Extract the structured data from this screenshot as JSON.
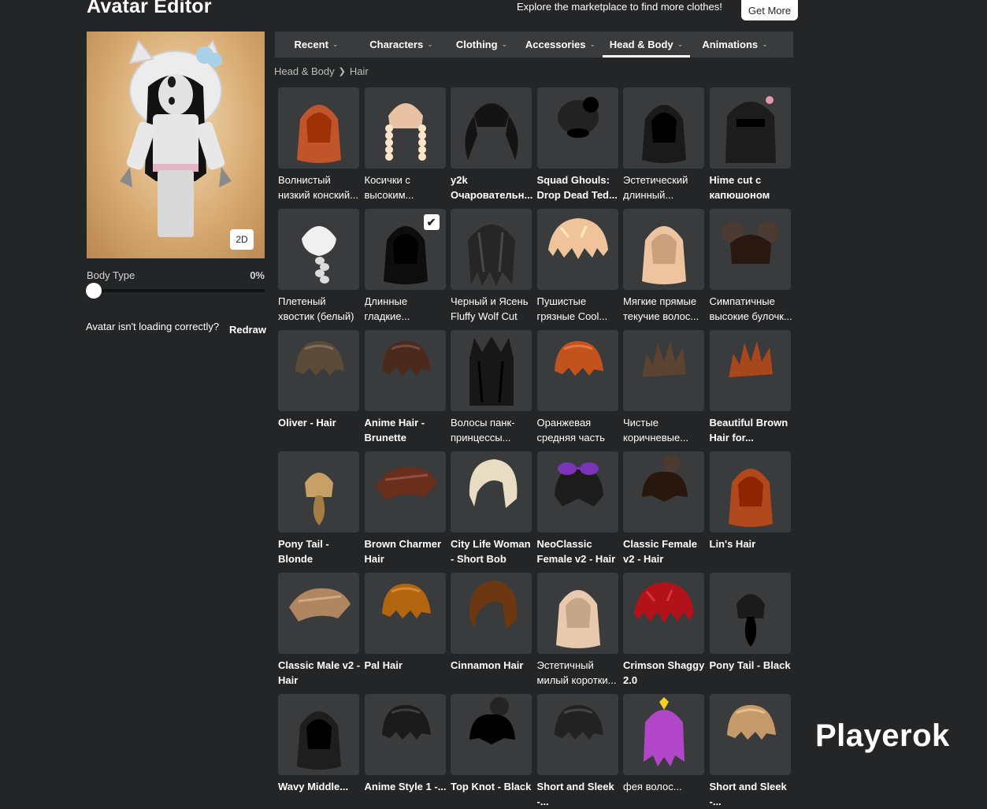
{
  "header": {
    "title": "Avatar Editor",
    "promo_text": "Explore the marketplace to find more clothes!",
    "get_more_label": "Get More"
  },
  "preview": {
    "view_toggle_label": "2D",
    "background_color": "#e2b884"
  },
  "body_type": {
    "label": "Body Type",
    "value_text": "0%",
    "value": 0
  },
  "loading": {
    "message": "Avatar isn't loading correctly?",
    "redraw_label": "Redraw"
  },
  "tabs": [
    {
      "label": "Recent",
      "active": false
    },
    {
      "label": "Characters",
      "active": false
    },
    {
      "label": "Clothing",
      "active": false
    },
    {
      "label": "Accessories",
      "active": false
    },
    {
      "label": "Head & Body",
      "active": true
    },
    {
      "label": "Animations",
      "active": false
    }
  ],
  "breadcrumb": {
    "parent": "Head & Body",
    "current": "Hair"
  },
  "items": [
    {
      "name": "Волнистый низкий конский...",
      "color": "#c0542a",
      "style": "long",
      "selected": false
    },
    {
      "name": "Косички с высоким...",
      "color": "#e7c2a5",
      "style": "braids",
      "selected": false
    },
    {
      "name": "y2k Очаровательн...",
      "color": "#141414",
      "style": "pigtails",
      "selected": false
    },
    {
      "name": "Squad Ghouls: Drop Dead Ted...",
      "color": "#222222",
      "style": "bun",
      "selected": false
    },
    {
      "name": "Эстетический длинный...",
      "color": "#1a1a1a",
      "style": "long",
      "selected": false
    },
    {
      "name": "Hime cut с капюшоном дл...",
      "color": "#1d1d1d",
      "style": "hime",
      "selected": false
    },
    {
      "name": "Плетеный хвостик (белый)",
      "color": "#f0f0f0",
      "style": "braid",
      "selected": false
    },
    {
      "name": "Длинные гладкие...",
      "color": "#0d0d0d",
      "style": "long",
      "selected": true
    },
    {
      "name": "Черный и Ясень Fluffy Wolf Cut",
      "color": "#262626",
      "style": "wolf",
      "selected": false
    },
    {
      "name": "Пушистые грязные Cool...",
      "color": "#efc49b",
      "style": "fluffy",
      "selected": false
    },
    {
      "name": "Мягкие прямые текучие волос...",
      "color": "#edc3a0",
      "style": "long",
      "selected": false
    },
    {
      "name": "Симпатичные высокие булочк...",
      "color": "#4b3b33",
      "style": "buns",
      "selected": false
    },
    {
      "name": "Oliver - Hair",
      "color": "#5b4a38",
      "style": "short",
      "selected": false
    },
    {
      "name": "Anime Hair - Brunette",
      "color": "#4a2a1d",
      "style": "short",
      "selected": false
    },
    {
      "name": "Волосы панк-принцессы...",
      "color": "#171717",
      "style": "punk",
      "selected": false
    },
    {
      "name": "Оранжевая средняя часть",
      "color": "#c2531e",
      "style": "short",
      "selected": false
    },
    {
      "name": "Чистые коричневые...",
      "color": "#5a4330",
      "style": "spiky",
      "selected": false
    },
    {
      "name": "Beautiful Brown Hair for...",
      "color": "#a8461c",
      "style": "spiky",
      "selected": false
    },
    {
      "name": "Pony Tail - Blonde",
      "color": "#c7a067",
      "style": "pony",
      "selected": false
    },
    {
      "name": "Brown Charmer Hair",
      "color": "#6a2e1d",
      "style": "swept",
      "selected": false
    },
    {
      "name": "City Life Woman - Short Bob",
      "color": "#e8dcc2",
      "style": "bob",
      "selected": false
    },
    {
      "name": "NeoClassic Female v2 - Hair",
      "color": "#1c1c1c",
      "style": "glasses",
      "selected": false
    },
    {
      "name": "Classic Female v2 - Hair",
      "color": "#4a3a2f",
      "style": "topbun",
      "selected": false
    },
    {
      "name": "Lin's Hair",
      "color": "#b1481d",
      "style": "long",
      "selected": false
    },
    {
      "name": "Classic Male v2 - Hair",
      "color": "#b08660",
      "style": "swept",
      "selected": false
    },
    {
      "name": "Pal Hair",
      "color": "#b2650f",
      "style": "short",
      "selected": false
    },
    {
      "name": "Cinnamon Hair",
      "color": "#6b3812",
      "style": "bob",
      "selected": false
    },
    {
      "name": "Эстетичный милый коротки...",
      "color": "#e9c9ad",
      "style": "long",
      "selected": false
    },
    {
      "name": "Crimson Shaggy 2.0",
      "color": "#b3121a",
      "style": "fluffy",
      "selected": false
    },
    {
      "name": "Pony Tail - Black",
      "color": "#1b1b1b",
      "style": "pony",
      "selected": false
    },
    {
      "name": "Wavy Middle...",
      "color": "#1e1e1e",
      "style": "long",
      "selected": false
    },
    {
      "name": "Anime Style 1 -...",
      "color": "#1a1a1a",
      "style": "short",
      "selected": false
    },
    {
      "name": "Top Knot - Black",
      "color": "#242424",
      "style": "topbun",
      "selected": false
    },
    {
      "name": "Short and Sleek -...",
      "color": "#222222",
      "style": "short",
      "selected": false
    },
    {
      "name": "фея волос...",
      "color": "#b246c8",
      "style": "fairy",
      "selected": false
    },
    {
      "name": "Short and Sleek -...",
      "color": "#c49a68",
      "style": "short",
      "selected": false
    }
  ],
  "watermark": "Playerok"
}
